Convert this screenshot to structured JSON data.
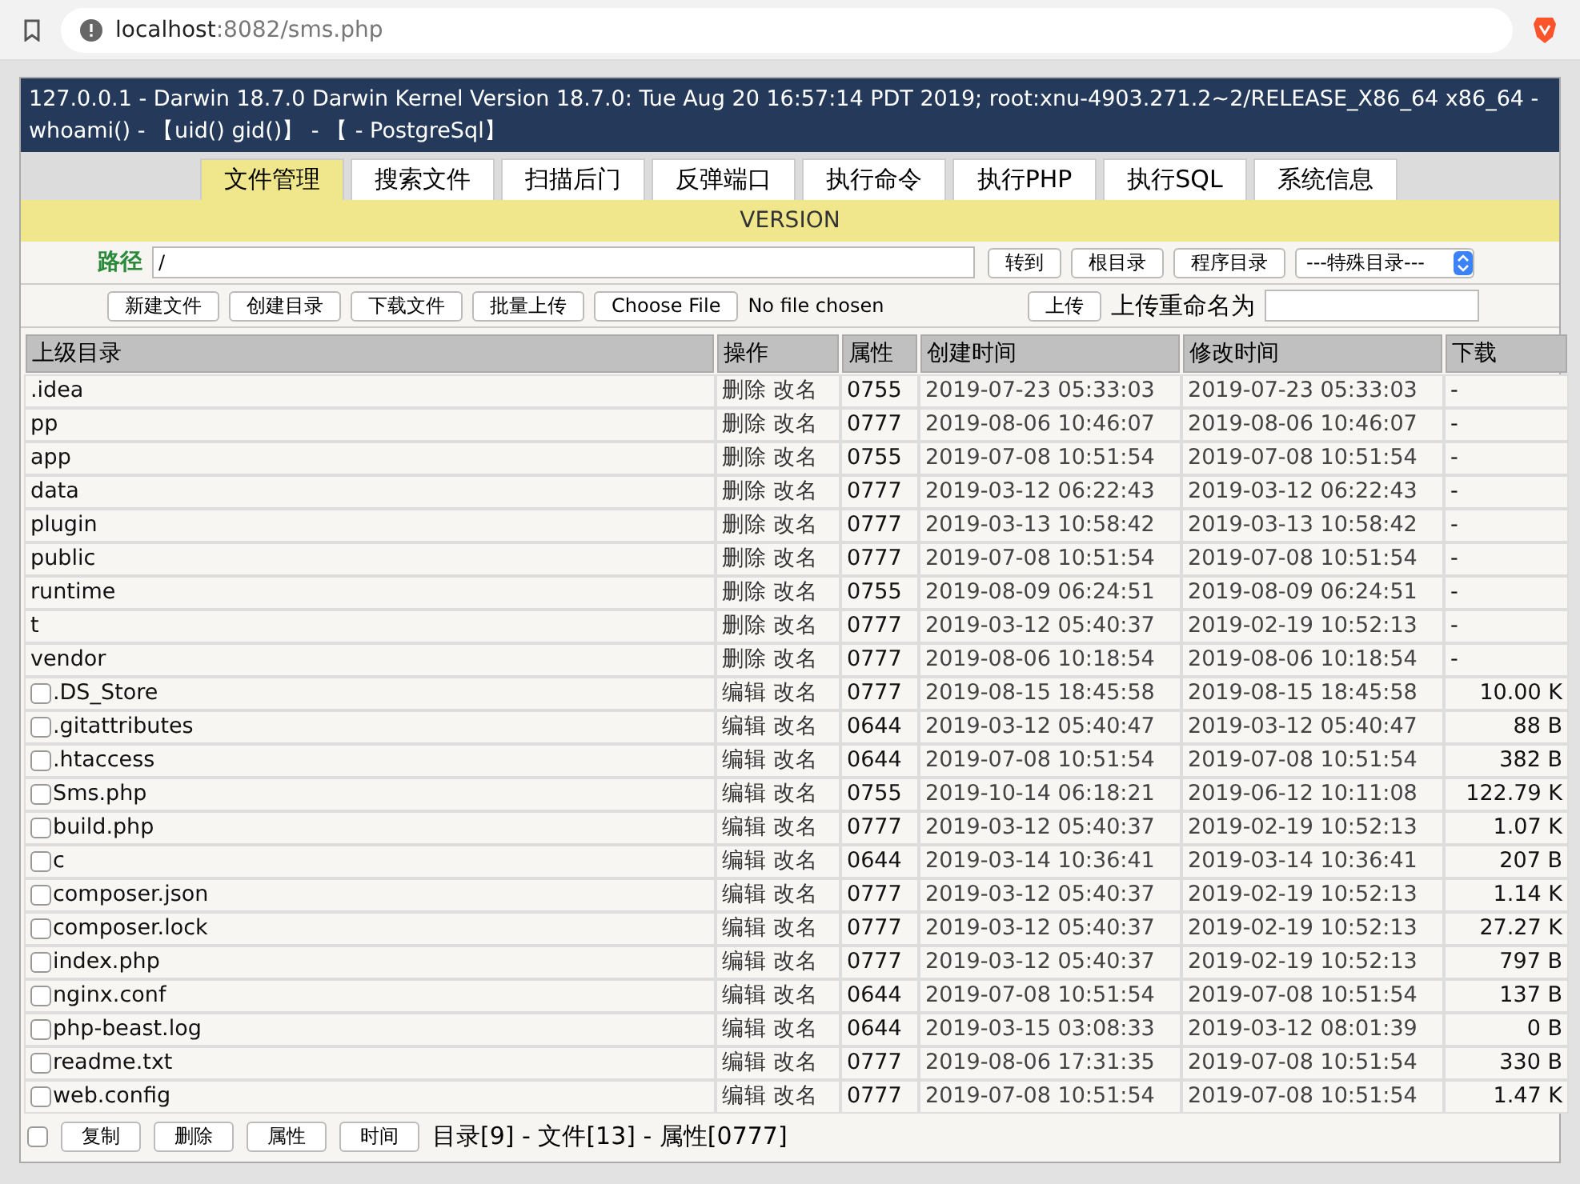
{
  "browser": {
    "url_host": "localhost",
    "url_rest": ":8082/sms.php"
  },
  "header": {
    "line_1": "127.0.0.1 - Darwin 18.7.0 Darwin Kernel Version 18.7.0: Tue Aug 20 16:57:14 PDT 2019; root:xnu-4903.271.2~2/RELEASE_X86_64 x86_64 -",
    "line_2": "whoami() - 【uid() gid()】 - 【 - PostgreSql】"
  },
  "tabs": [
    {
      "label": "文件管理",
      "selected": true
    },
    {
      "label": "搜索文件",
      "selected": false
    },
    {
      "label": "扫描后门",
      "selected": false
    },
    {
      "label": "反弹端口",
      "selected": false
    },
    {
      "label": "执行命令",
      "selected": false
    },
    {
      "label": "执行PHP",
      "selected": false
    },
    {
      "label": "执行SQL",
      "selected": false
    },
    {
      "label": "系统信息",
      "selected": false
    }
  ],
  "version_bar": "VERSION",
  "path_row": {
    "label": "路径",
    "value": "/",
    "buttons": [
      "转到",
      "根目录",
      "程序目录"
    ],
    "select": "---特殊目录---"
  },
  "action_row": {
    "buttons": [
      "新建文件",
      "创建目录",
      "下载文件",
      "批量上传"
    ],
    "file_button": "Choose File",
    "file_status": "No file chosen",
    "upload_button": "上传",
    "rename_label": "上传重命名为"
  },
  "table": {
    "columns": [
      "上级目录",
      "操作",
      "属性",
      "创建时间",
      "修改时间",
      "下载"
    ],
    "rows": [
      {
        "kind": "dir",
        "name": ".idea",
        "ops": [
          "删除",
          "改名"
        ],
        "attr": "0755",
        "created": "2019-07-23 05:33:03",
        "modified": "2019-07-23 05:33:03",
        "size": "-"
      },
      {
        "kind": "dir",
        "name": "pp",
        "ops": [
          "删除",
          "改名"
        ],
        "attr": "0777",
        "created": "2019-08-06 10:46:07",
        "modified": "2019-08-06 10:46:07",
        "size": "-"
      },
      {
        "kind": "dir",
        "name": "app",
        "ops": [
          "删除",
          "改名"
        ],
        "attr": "0755",
        "created": "2019-07-08 10:51:54",
        "modified": "2019-07-08 10:51:54",
        "size": "-"
      },
      {
        "kind": "dir",
        "name": "data",
        "ops": [
          "删除",
          "改名"
        ],
        "attr": "0777",
        "created": "2019-03-12 06:22:43",
        "modified": "2019-03-12 06:22:43",
        "size": "-"
      },
      {
        "kind": "dir",
        "name": "plugin",
        "ops": [
          "删除",
          "改名"
        ],
        "attr": "0777",
        "created": "2019-03-13 10:58:42",
        "modified": "2019-03-13 10:58:42",
        "size": "-"
      },
      {
        "kind": "dir",
        "name": "public",
        "ops": [
          "删除",
          "改名"
        ],
        "attr": "0777",
        "created": "2019-07-08 10:51:54",
        "modified": "2019-07-08 10:51:54",
        "size": "-"
      },
      {
        "kind": "dir",
        "name": "runtime",
        "ops": [
          "删除",
          "改名"
        ],
        "attr": "0755",
        "created": "2019-08-09 06:24:51",
        "modified": "2019-08-09 06:24:51",
        "size": "-"
      },
      {
        "kind": "dir",
        "name": "t",
        "ops": [
          "删除",
          "改名"
        ],
        "attr": "0777",
        "created": "2019-03-12 05:40:37",
        "modified": "2019-02-19 10:52:13",
        "size": "-"
      },
      {
        "kind": "dir",
        "name": "vendor",
        "ops": [
          "删除",
          "改名"
        ],
        "attr": "0777",
        "created": "2019-08-06 10:18:54",
        "modified": "2019-08-06 10:18:54",
        "size": "-"
      },
      {
        "kind": "file",
        "checked": false,
        "name": ".DS_Store",
        "ops": [
          "编辑",
          "改名"
        ],
        "attr": "0777",
        "created": "2019-08-15 18:45:58",
        "modified": "2019-08-15 18:45:58",
        "size": "10.00 K"
      },
      {
        "kind": "file",
        "checked": false,
        "name": ".gitattributes",
        "ops": [
          "编辑",
          "改名"
        ],
        "attr": "0644",
        "created": "2019-03-12 05:40:47",
        "modified": "2019-03-12 05:40:47",
        "size": "88 B"
      },
      {
        "kind": "file",
        "checked": false,
        "name": ".htaccess",
        "ops": [
          "编辑",
          "改名"
        ],
        "attr": "0644",
        "created": "2019-07-08 10:51:54",
        "modified": "2019-07-08 10:51:54",
        "size": "382 B"
      },
      {
        "kind": "file",
        "checked": false,
        "name": "Sms.php",
        "ops": [
          "编辑",
          "改名"
        ],
        "attr": "0755",
        "created": "2019-10-14 06:18:21",
        "modified": "2019-06-12 10:11:08",
        "size": "122.79 K"
      },
      {
        "kind": "file",
        "checked": false,
        "name": "build.php",
        "ops": [
          "编辑",
          "改名"
        ],
        "attr": "0777",
        "created": "2019-03-12 05:40:37",
        "modified": "2019-02-19 10:52:13",
        "size": "1.07 K"
      },
      {
        "kind": "file",
        "checked": false,
        "name": "c",
        "ops": [
          "编辑",
          "改名"
        ],
        "attr": "0644",
        "created": "2019-03-14 10:36:41",
        "modified": "2019-03-14 10:36:41",
        "size": "207 B"
      },
      {
        "kind": "file",
        "checked": false,
        "name": "composer.json",
        "ops": [
          "编辑",
          "改名"
        ],
        "attr": "0777",
        "created": "2019-03-12 05:40:37",
        "modified": "2019-02-19 10:52:13",
        "size": "1.14 K"
      },
      {
        "kind": "file",
        "checked": false,
        "name": "composer.lock",
        "ops": [
          "编辑",
          "改名"
        ],
        "attr": "0777",
        "created": "2019-03-12 05:40:37",
        "modified": "2019-02-19 10:52:13",
        "size": "27.27 K"
      },
      {
        "kind": "file",
        "checked": false,
        "name": "index.php",
        "ops": [
          "编辑",
          "改名"
        ],
        "attr": "0777",
        "created": "2019-03-12 05:40:37",
        "modified": "2019-02-19 10:52:13",
        "size": "797 B"
      },
      {
        "kind": "file",
        "checked": false,
        "name": "nginx.conf",
        "ops": [
          "编辑",
          "改名"
        ],
        "attr": "0644",
        "created": "2019-07-08 10:51:54",
        "modified": "2019-07-08 10:51:54",
        "size": "137 B"
      },
      {
        "kind": "file",
        "checked": false,
        "name": "php-beast.log",
        "ops": [
          "编辑",
          "改名"
        ],
        "attr": "0644",
        "created": "2019-03-15 03:08:33",
        "modified": "2019-03-12 08:01:39",
        "size": "0 B"
      },
      {
        "kind": "file",
        "checked": false,
        "name": "readme.txt",
        "ops": [
          "编辑",
          "改名"
        ],
        "attr": "0777",
        "created": "2019-08-06 17:31:35",
        "modified": "2019-07-08 10:51:54",
        "size": "330 B"
      },
      {
        "kind": "file",
        "checked": false,
        "name": "web.config",
        "ops": [
          "编辑",
          "改名"
        ],
        "attr": "0777",
        "created": "2019-07-08 10:51:54",
        "modified": "2019-07-08 10:51:54",
        "size": "1.47 K"
      }
    ]
  },
  "footer": {
    "checked": false,
    "buttons": [
      "复制",
      "删除",
      "属性",
      "时间"
    ],
    "summary": "目录[9] - 文件[13] - 属性[0777]"
  }
}
